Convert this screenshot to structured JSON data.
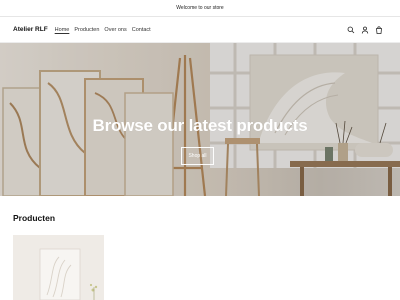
{
  "announcement": {
    "text": "Welcome to our store"
  },
  "header": {
    "logo": "Atelier RLF",
    "nav": [
      {
        "label": "Home",
        "active": true
      },
      {
        "label": "Producten",
        "active": false
      },
      {
        "label": "Over ons",
        "active": false
      },
      {
        "label": "Contact",
        "active": false
      }
    ],
    "icons": [
      "search-icon",
      "account-icon",
      "cart-icon"
    ]
  },
  "hero": {
    "title": "Browse our latest products",
    "button_label": "Shop all"
  },
  "products_section": {
    "title": "Producten"
  }
}
